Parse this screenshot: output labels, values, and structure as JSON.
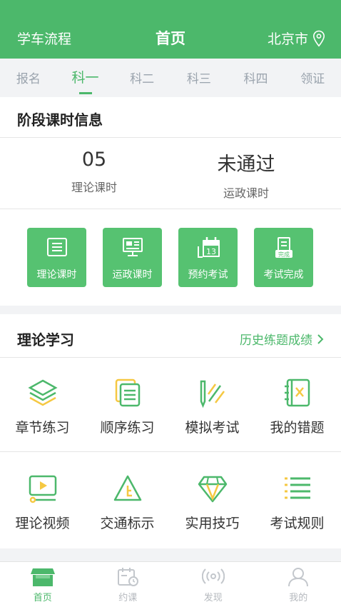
{
  "header": {
    "left": "学车流程",
    "title": "首页",
    "city": "北京市"
  },
  "tabs": [
    "报名",
    "科一",
    "科二",
    "科三",
    "科四",
    "领证"
  ],
  "active_tab": 1,
  "stage": {
    "title": "阶段课时信息",
    "stats": [
      {
        "value": "05",
        "label": "理论课时"
      },
      {
        "value": "未通过",
        "label": "运政课时"
      }
    ],
    "buttons": [
      {
        "label": "理论课时",
        "icon": "book-icon"
      },
      {
        "label": "运政课时",
        "icon": "monitor-icon"
      },
      {
        "label": "预约考试",
        "icon": "calendar-icon",
        "badge": "13"
      },
      {
        "label": "考试完成",
        "icon": "certificate-icon",
        "badge": "完成"
      }
    ]
  },
  "theory": {
    "title": "理论学习",
    "history": "历史练题成绩",
    "items": [
      {
        "label": "章节练习",
        "icon": "layers-icon"
      },
      {
        "label": "顺序练习",
        "icon": "notes-icon"
      },
      {
        "label": "模拟考试",
        "icon": "pencil-icon"
      },
      {
        "label": "我的错题",
        "icon": "wrong-book-icon"
      },
      {
        "label": "理论视频",
        "icon": "video-icon"
      },
      {
        "label": "交通标示",
        "icon": "traffic-sign-icon"
      },
      {
        "label": "实用技巧",
        "icon": "diamond-icon"
      },
      {
        "label": "考试规则",
        "icon": "list-icon"
      }
    ]
  },
  "tabbar": [
    {
      "label": "首页",
      "icon": "store-icon"
    },
    {
      "label": "约课",
      "icon": "schedule-icon"
    },
    {
      "label": "发现",
      "icon": "broadcast-icon"
    },
    {
      "label": "我的",
      "icon": "user-icon"
    }
  ],
  "colors": {
    "brand": "#4cb86b",
    "button": "#56c271",
    "accent_yellow": "#f5c842"
  }
}
